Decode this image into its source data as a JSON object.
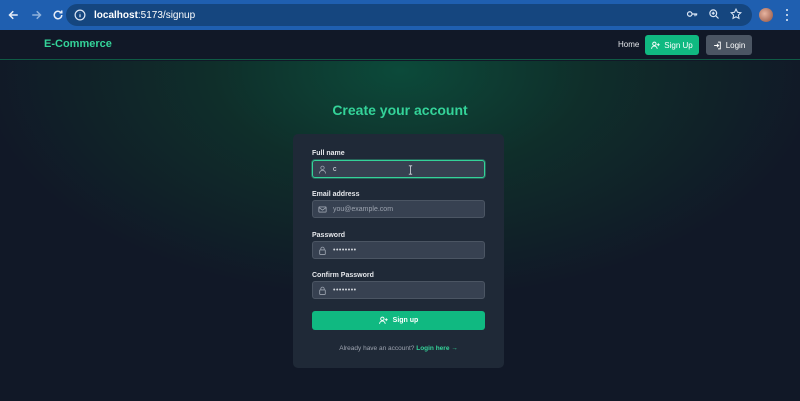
{
  "browser": {
    "url_host": "localhost",
    "url_path": ":5173/signup"
  },
  "header": {
    "brand": "E-Commerce",
    "nav_home": "Home",
    "signup_label": "Sign Up",
    "login_label": "Login"
  },
  "page": {
    "title": "Create your account"
  },
  "form": {
    "full_name_label": "Full name",
    "full_name_value": "c",
    "email_label": "Email address",
    "email_placeholder": "you@example.com",
    "password_label": "Password",
    "password_value": "••••••••",
    "confirm_label": "Confirm Password",
    "confirm_value": "••••••••",
    "submit_label": "Sign up",
    "footer_prefix": "Already have an account?",
    "footer_link": "Login here"
  },
  "colors": {
    "accent": "#34d399",
    "button": "#10b981",
    "card": "#1f2937",
    "browser_bar": "#1f5fb0"
  },
  "icons": [
    "arrow-left-icon",
    "arrow-right-icon",
    "reload-icon",
    "site-info-icon",
    "key-icon",
    "zoom-icon",
    "star-icon",
    "user-plus-icon",
    "login-icon",
    "user-icon",
    "mail-icon",
    "lock-icon",
    "arrow-right-small-icon"
  ]
}
